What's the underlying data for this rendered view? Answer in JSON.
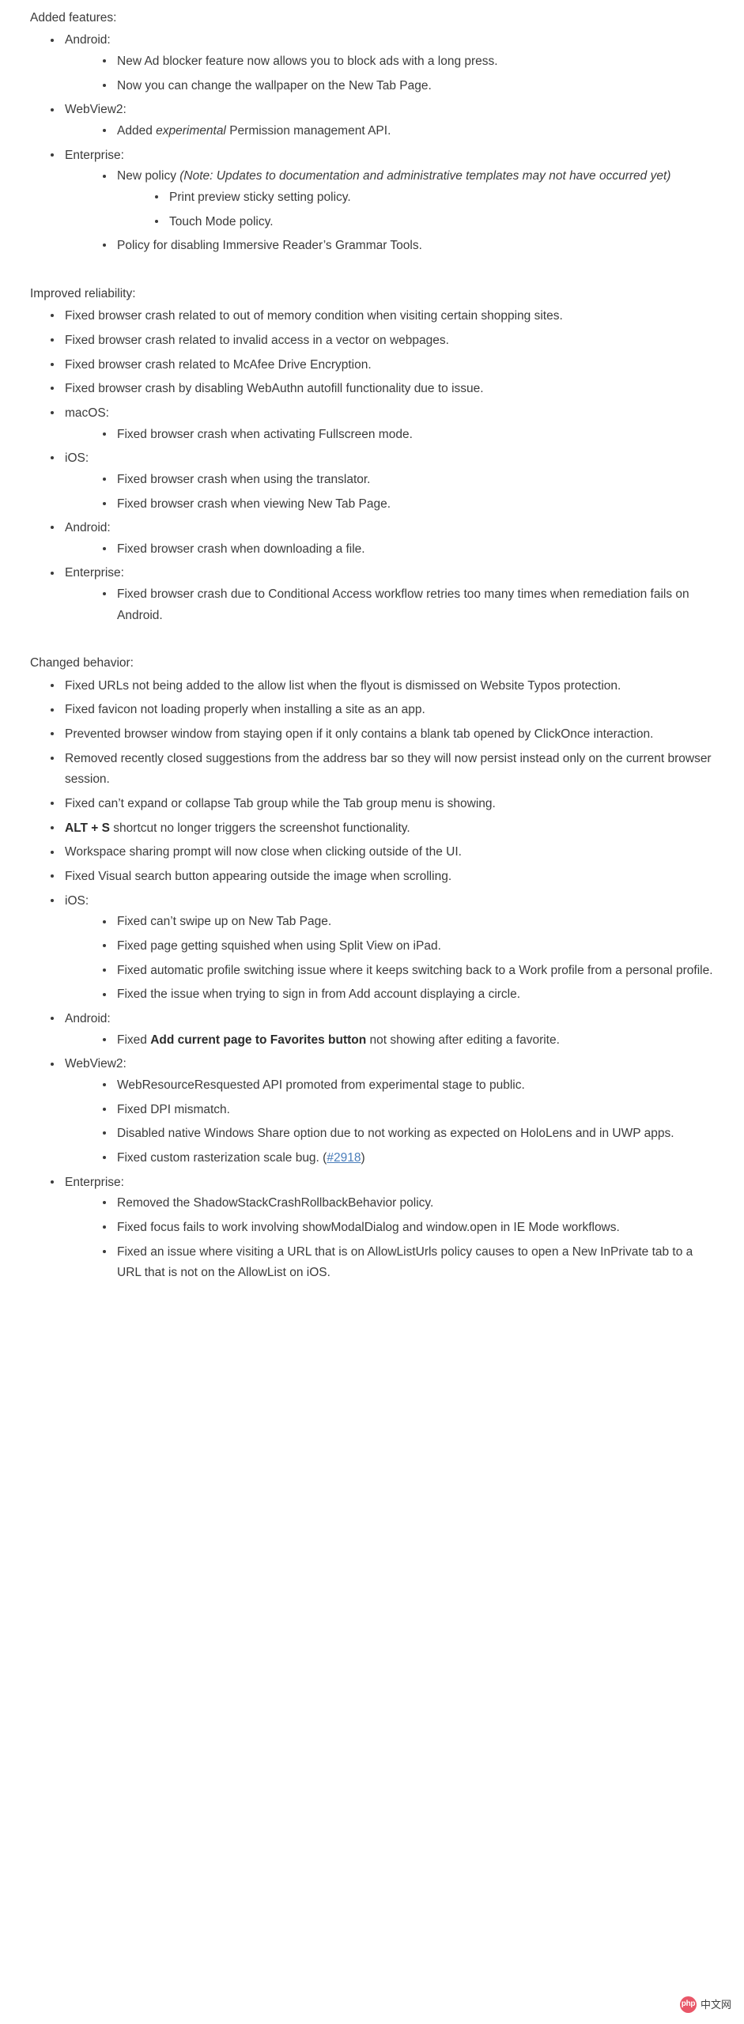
{
  "document": {
    "sections": [
      {
        "id": "added-features",
        "title": "Added features:",
        "items": [
          {
            "label": "Android:",
            "children": [
              {
                "label": "New Ad blocker feature now allows you to block ads with a long press."
              },
              {
                "label": "Now you can change the wallpaper on the New Tab Page."
              }
            ]
          },
          {
            "label": "WebView2:",
            "children": [
              {
                "label_pre": "Added ",
                "label_em": "experimental",
                "label_post": " Permission management API."
              }
            ]
          },
          {
            "label": "Enterprise:",
            "children": [
              {
                "label_pre": "New policy ",
                "label_em": "(Note: Updates to documentation and administrative templates may not have occurred yet)",
                "children": [
                  {
                    "label": "Print preview sticky setting policy."
                  },
                  {
                    "label": "Touch Mode policy."
                  }
                ]
              },
              {
                "label": "Policy for disabling Immersive Reader’s Grammar Tools."
              }
            ]
          }
        ]
      },
      {
        "id": "improved-reliability",
        "title": "Improved reliability:",
        "items": [
          {
            "label": "Fixed browser crash related to out of memory condition when visiting certain shopping sites."
          },
          {
            "label": "Fixed browser crash related to invalid access in a vector on webpages."
          },
          {
            "label": "Fixed browser crash related to McAfee Drive Encryption."
          },
          {
            "label": "Fixed browser crash by disabling WebAuthn autofill functionality due to issue."
          },
          {
            "label": "macOS:",
            "children": [
              {
                "label": "Fixed browser crash when activating Fullscreen mode."
              }
            ]
          },
          {
            "label": "iOS:",
            "children": [
              {
                "label": "Fixed browser crash when using the translator."
              },
              {
                "label": "Fixed browser crash when viewing New Tab Page."
              }
            ]
          },
          {
            "label": "Android:",
            "children": [
              {
                "label": "Fixed browser crash when downloading a file."
              }
            ]
          },
          {
            "label": "Enterprise:",
            "children": [
              {
                "label": "Fixed browser crash due to Conditional Access workflow retries too many times when remediation fails on Android."
              }
            ]
          }
        ]
      },
      {
        "id": "changed-behavior",
        "title": "Changed behavior:",
        "items": [
          {
            "label": "Fixed URLs not being added to the allow list when the flyout is dismissed on Website Typos protection."
          },
          {
            "label": "Fixed favicon not loading properly when installing a site as an app."
          },
          {
            "label": "Prevented browser window from staying open if it only contains a blank tab opened by ClickOnce interaction."
          },
          {
            "label": "Removed recently closed suggestions from the address bar so they will now persist instead only on the current browser session."
          },
          {
            "label": "Fixed can’t expand or collapse Tab group while the Tab group menu is showing."
          },
          {
            "label_strong": "ALT + S",
            "label_post": " shortcut no longer triggers the screenshot functionality."
          },
          {
            "label": "Workspace sharing prompt will now close when clicking outside of the UI."
          },
          {
            "label": "Fixed Visual search button appearing outside the image when scrolling."
          },
          {
            "label": "iOS:",
            "children": [
              {
                "label": "Fixed can’t swipe up on New Tab Page."
              },
              {
                "label": "Fixed page getting squished when using Split View on iPad."
              },
              {
                "label": "Fixed automatic profile switching issue where it keeps switching back to a Work profile from a personal profile."
              },
              {
                "label": "Fixed the issue when trying to sign in from Add account displaying a circle."
              }
            ]
          },
          {
            "label": "Android:",
            "children": [
              {
                "label_pre": "Fixed ",
                "label_strong": "Add current page to Favorites button",
                "label_post": " not showing after editing a favorite."
              }
            ]
          },
          {
            "label": "WebView2:",
            "children": [
              {
                "label": "WebResourceResquested API promoted from experimental stage to public."
              },
              {
                "label": "Fixed DPI mismatch."
              },
              {
                "label": "Disabled native Windows Share option due to not working as expected on HoloLens and in UWP apps."
              },
              {
                "label_pre": "Fixed custom rasterization scale bug. (",
                "link": "#2918",
                "label_post": ")"
              }
            ]
          },
          {
            "label": "Enterprise:",
            "children": [
              {
                "label": "Removed the ShadowStackCrashRollbackBehavior policy."
              },
              {
                "label": "Fixed focus fails to work involving showModalDialog and window.open in IE Mode workflows."
              },
              {
                "label": "Fixed an issue where visiting a URL that is on AllowListUrls policy causes to open a New InPrivate tab to a URL that is not on the AllowList on iOS."
              }
            ]
          }
        ]
      }
    ]
  },
  "watermark": {
    "badge": "php",
    "text": "中文网"
  },
  "colors": {
    "text": "#3b3b3b",
    "link": "#4a7ebb",
    "badge": "#e8485c"
  }
}
